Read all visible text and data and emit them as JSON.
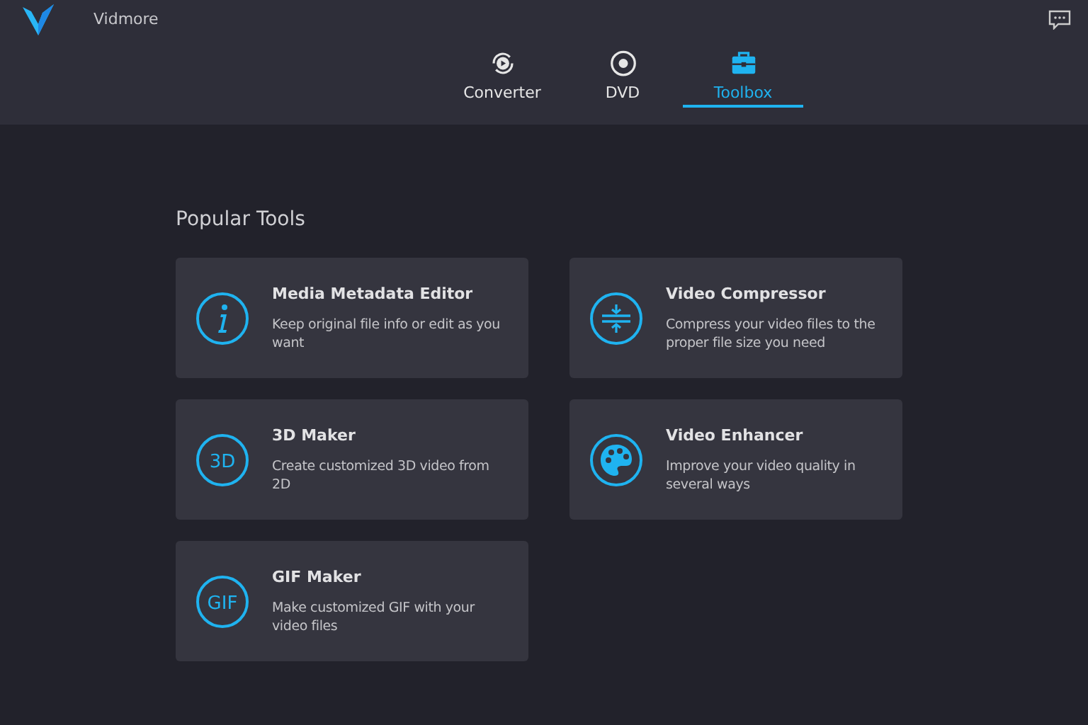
{
  "app": {
    "name": "Vidmore"
  },
  "tabs": [
    {
      "label": "Converter",
      "selected": false
    },
    {
      "label": "DVD",
      "selected": false
    },
    {
      "label": "Toolbox",
      "selected": true
    }
  ],
  "section_title": "Popular Tools",
  "tools": [
    {
      "title": "Media Metadata Editor",
      "description": "Keep original file info or edit as you want",
      "kind": "info"
    },
    {
      "title": "Video Compressor",
      "description": "Compress your video files to the proper file size you need",
      "kind": "compress"
    },
    {
      "title": "3D Maker",
      "description": "Create customized 3D video from 2D",
      "kind": "text",
      "icon_text": "3D"
    },
    {
      "title": "Video Enhancer",
      "description": "Improve your video quality in several ways",
      "kind": "palette"
    },
    {
      "title": "GIF Maker",
      "description": "Make customized GIF with your video files",
      "kind": "text",
      "icon_text": "GIF"
    }
  ]
}
